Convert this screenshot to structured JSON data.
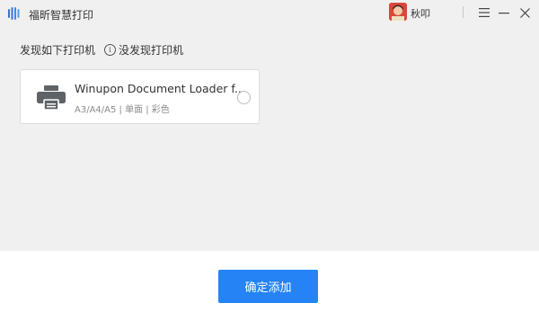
{
  "app": {
    "title": "福昕智慧打印",
    "user_name": "秋叩",
    "accent_color": "#2583f5"
  },
  "section": {
    "found_label": "发现如下打印机",
    "not_found_label": "没发现打印机",
    "info_icon": "info-icon"
  },
  "printers": [
    {
      "name": "Winupon Document Loader f...",
      "meta": "A3/A4/A5 | 单面 | 彩色",
      "selected": false
    }
  ],
  "footer": {
    "confirm_label": "确定添加"
  },
  "icons": {
    "logo": "foxit-logo-icon",
    "menu": "hamburger-menu-icon",
    "minimize": "minimize-icon",
    "close": "close-icon",
    "printer": "printer-icon"
  }
}
